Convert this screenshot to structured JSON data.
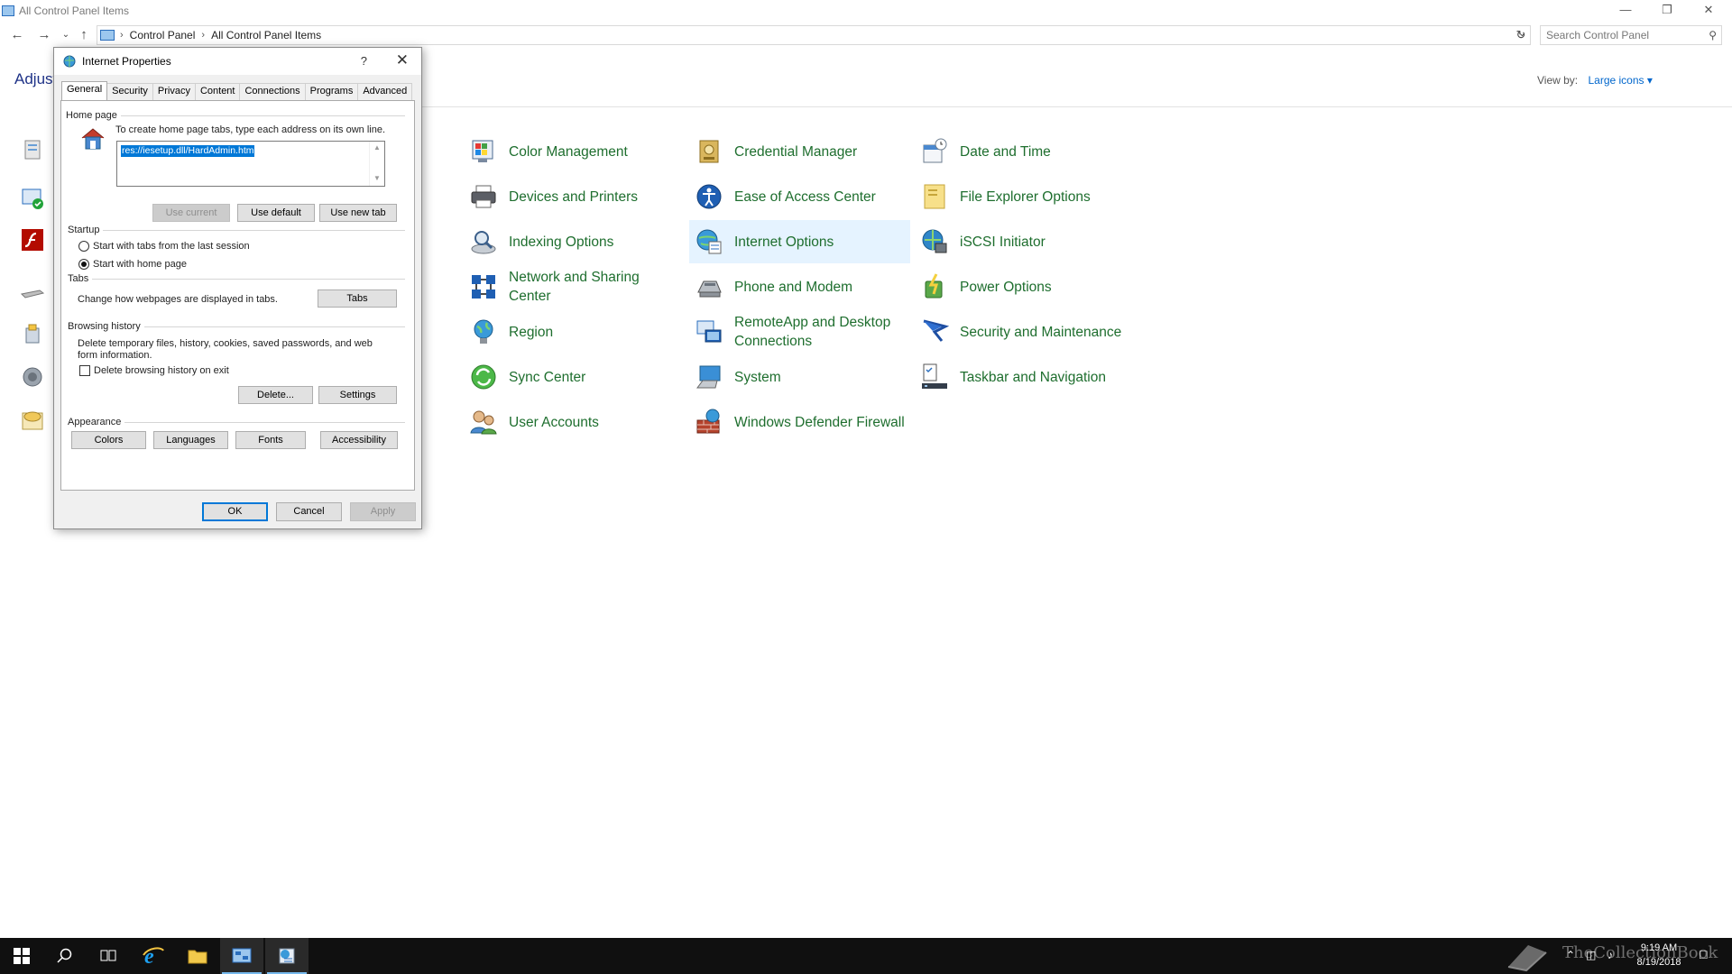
{
  "window": {
    "title": "All Control Panel Items"
  },
  "address": {
    "crumbs": [
      "Control Panel",
      "All Control Panel Items"
    ],
    "search_placeholder": "Search Control Panel"
  },
  "header": {
    "title": "Adjust",
    "view_by_label": "View by:",
    "view_by_value": "Large icons"
  },
  "items": [
    {
      "label": "Color Management",
      "icon": "color-management-icon"
    },
    {
      "label": "Credential Manager",
      "icon": "credential-manager-icon"
    },
    {
      "label": "Date and Time",
      "icon": "date-time-icon"
    },
    {
      "label": "Devices and Printers",
      "icon": "printer-icon"
    },
    {
      "label": "Ease of Access Center",
      "icon": "ease-of-access-icon"
    },
    {
      "label": "File Explorer Options",
      "icon": "folder-options-icon"
    },
    {
      "label": "Indexing Options",
      "icon": "indexing-icon"
    },
    {
      "label": "Internet Options",
      "icon": "internet-options-icon"
    },
    {
      "label": "iSCSI Initiator",
      "icon": "iscsi-icon"
    },
    {
      "label": "Network and Sharing Center",
      "icon": "network-icon"
    },
    {
      "label": "Phone and Modem",
      "icon": "phone-modem-icon"
    },
    {
      "label": "Power Options",
      "icon": "power-options-icon"
    },
    {
      "label": "Region",
      "icon": "region-icon"
    },
    {
      "label": "RemoteApp and Desktop Connections",
      "icon": "remoteapp-icon"
    },
    {
      "label": "Security and Maintenance",
      "icon": "flag-icon"
    },
    {
      "label": "Sync Center",
      "icon": "sync-icon"
    },
    {
      "label": "System",
      "icon": "system-icon"
    },
    {
      "label": "Taskbar and Navigation",
      "icon": "taskbar-icon"
    },
    {
      "label": "User Accounts",
      "icon": "user-accounts-icon"
    },
    {
      "label": "Windows Defender Firewall",
      "icon": "firewall-icon"
    }
  ],
  "dialog": {
    "title": "Internet Properties",
    "help": "?",
    "close": "✕",
    "tabs": [
      "General",
      "Security",
      "Privacy",
      "Content",
      "Connections",
      "Programs",
      "Advanced"
    ],
    "home_page": {
      "group": "Home page",
      "desc": "To create home page tabs, type each address on its own line.",
      "value": "res://iesetup.dll/HardAdmin.htm",
      "use_current": "Use current",
      "use_default": "Use default",
      "use_new_tab": "Use new tab"
    },
    "startup": {
      "group": "Startup",
      "option1": "Start with tabs from the last session",
      "option2": "Start with home page"
    },
    "tabs_group": {
      "group": "Tabs",
      "desc": "Change how webpages are displayed in tabs.",
      "button": "Tabs"
    },
    "history": {
      "group": "Browsing history",
      "desc": "Delete temporary files, history, cookies, saved passwords, and web form information.",
      "checkbox": "Delete browsing history on exit",
      "delete": "Delete...",
      "settings": "Settings"
    },
    "appearance": {
      "group": "Appearance",
      "colors": "Colors",
      "languages": "Languages",
      "fonts": "Fonts",
      "accessibility": "Accessibility"
    },
    "ok": "OK",
    "cancel": "Cancel",
    "apply": "Apply"
  },
  "taskbar": {
    "time": "9:19 AM",
    "date": "8/19/2018",
    "watermark": "TheCollectionBook"
  },
  "colors": {
    "link_green": "#1e6e2e",
    "selection_blue": "#0078d7",
    "hover_bg": "#e5f3ff",
    "taskbar": "#101010"
  }
}
